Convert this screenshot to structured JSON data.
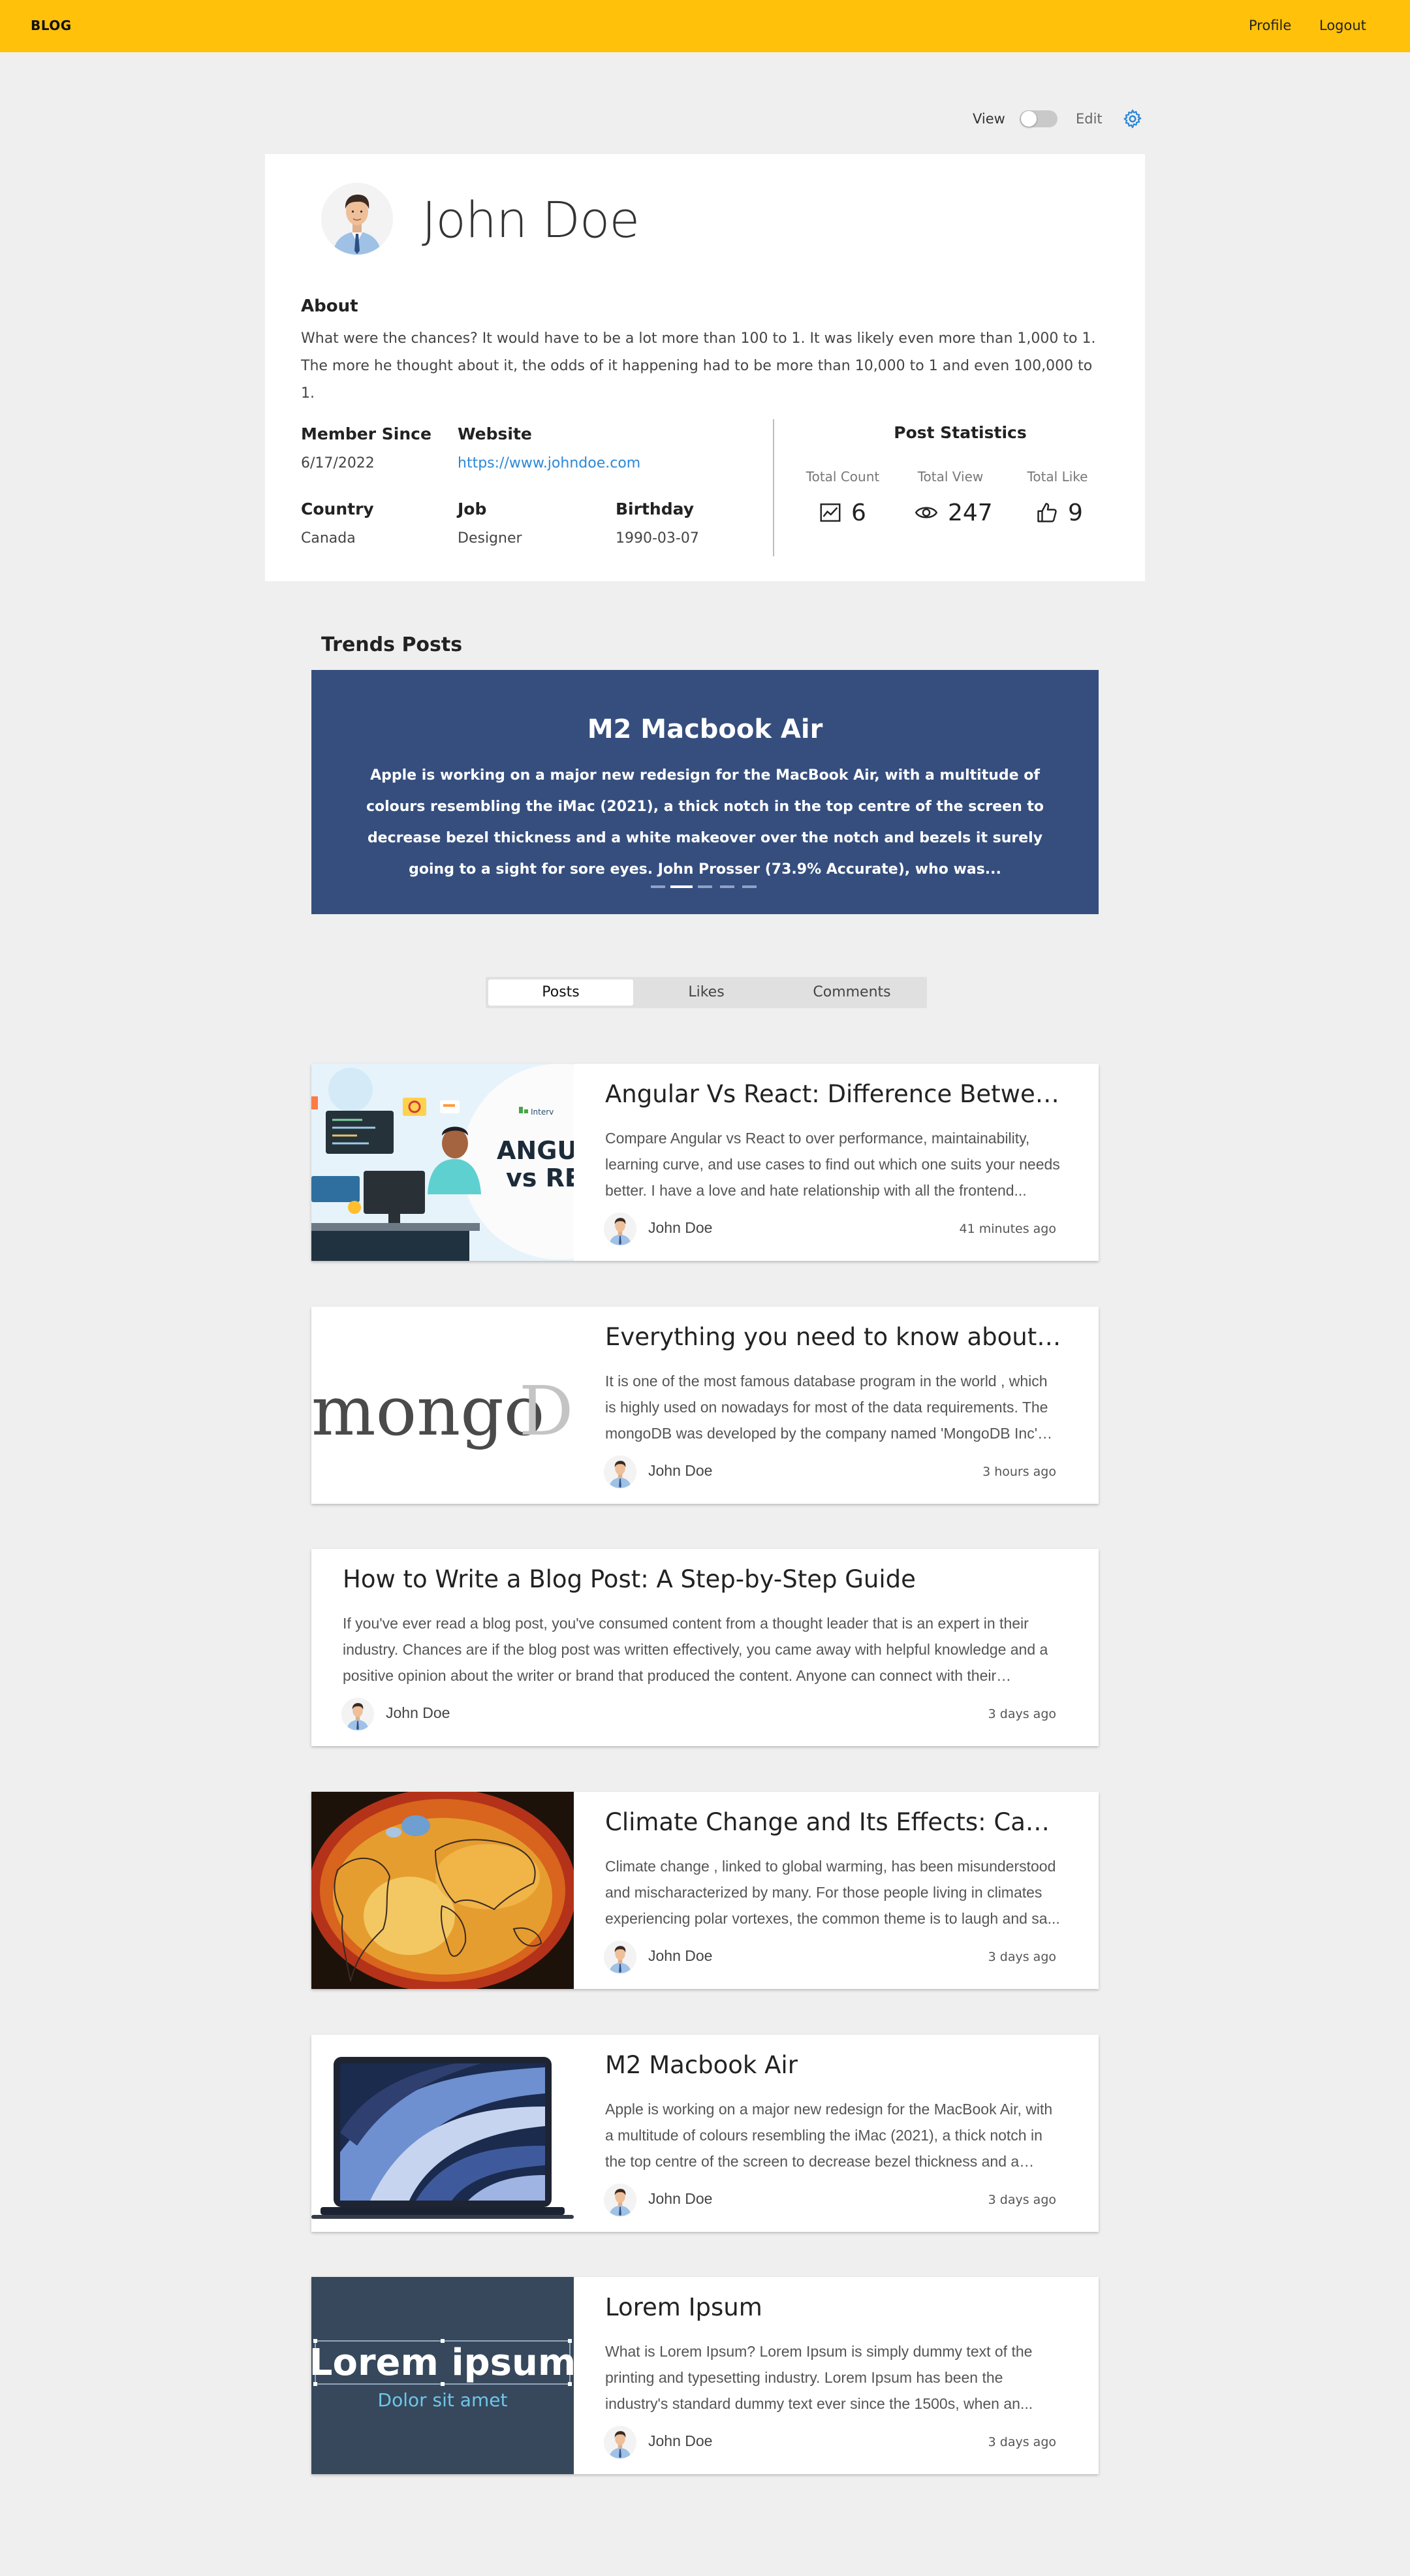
{
  "header": {
    "brand": "BLOG",
    "nav": [
      "Profile",
      "Logout"
    ]
  },
  "mode": {
    "view_label": "View",
    "edit_label": "Edit",
    "toggle_state": "off"
  },
  "profile": {
    "name": "John Doe",
    "about_title": "About",
    "about_text": "What were the chances? It would have to be a lot more than 100 to 1. It was likely even more than 1,000 to 1. The more he thought about it, the odds of it happening had to be more than 10,000 to 1 and even 100,000 to 1.",
    "member_since_label": "Member Since",
    "member_since": "6/17/2022",
    "website_label": "Website",
    "website": "https://www.johndoe.com",
    "country_label": "Country",
    "country": "Canada",
    "job_label": "Job",
    "job": "Designer",
    "birthday_label": "Birthday",
    "birthday": "1990-03-07"
  },
  "stats": {
    "title": "Post Statistics",
    "items": [
      {
        "label": "Total Count",
        "value": "6",
        "icon": "trend-chart-icon"
      },
      {
        "label": "Total View",
        "value": "247",
        "icon": "eye-icon"
      },
      {
        "label": "Total Like",
        "value": "9",
        "icon": "thumbs-up-icon"
      }
    ]
  },
  "trends": {
    "title": "Trends Posts",
    "slide_title": "M2 Macbook Air",
    "slide_text": "Apple is working on a major new redesign for the MacBook Air, with a multitude of colours resembling the iMac (2021), a thick notch in the top centre of the screen to decrease bezel thickness and a white makeover over the notch and bezels it surely going to a sight for sore eyes. John Prosser (73.9% Accurate), who was...",
    "slide_count": 5,
    "active_slide": 2
  },
  "tabs": [
    "Posts",
    "Likes",
    "Comments"
  ],
  "active_tab": "Posts",
  "posts": [
    {
      "title": "Angular Vs React: Difference Between Ang...",
      "excerpt": "Compare Angular vs React to over performance, maintainability, learning curve, and use cases to find out which one suits your needs better. I have a love and hate relationship with all the frontend...",
      "author": "John Doe",
      "time": "41 minutes ago",
      "thumb": "angular-react",
      "thumb_text": [
        "ANGUL",
        "vs REA",
        "Interv"
      ]
    },
    {
      "title": "Everything you need to know about Mong...",
      "excerpt": "It is one of the most famous database program in the world , which is highly used on nowadays for most of the data requirements. The mongoDB was developed by the company named 'MongoDB Inc' a...",
      "author": "John Doe",
      "time": "3 hours ago",
      "thumb": "mongodb",
      "thumb_text": [
        "mongo",
        "D"
      ]
    },
    {
      "title": "How to Write a Blog Post: A Step-by-Step Guide",
      "excerpt": "If you've ever read a blog post, you've consumed content from a thought leader that is an expert in their industry. Chances are if the blog post was written effectively, you came away with helpful knowledge and a positive opinion about the writer or brand that produced the content. Anyone can connect with their audienc...",
      "author": "John Doe",
      "time": "3 days ago",
      "thumb": "none"
    },
    {
      "title": "Climate Change and Its Effects: Can We Un...",
      "excerpt": "Climate change , linked to global warming, has been misunderstood and mischaracterized by many. For those people living in climates experiencing polar vortexes, the common theme is to laugh and sa...",
      "author": "John Doe",
      "time": "3 days ago",
      "thumb": "climate-map"
    },
    {
      "title": "M2 Macbook Air",
      "excerpt": "Apple is working on a major new redesign for the MacBook Air, with a multitude of colours resembling the iMac (2021), a thick notch in the top centre of the screen to decrease bezel thickness and a white...",
      "author": "John Doe",
      "time": "3 days ago",
      "thumb": "macbook"
    },
    {
      "title": "Lorem Ipsum",
      "excerpt": "What is Lorem Ipsum? Lorem Ipsum is simply dummy text of the printing and typesetting industry. Lorem Ipsum has been the industry's standard dummy text ever since the 1500s, when an...",
      "author": "John Doe",
      "time": "3 days ago",
      "thumb": "lorem",
      "thumb_text": [
        "Lorem ipsum",
        "Dolor sit amet"
      ]
    }
  ],
  "colors": {
    "header": "#ffc10a",
    "carousel": "#354e7e",
    "link": "#2d88d8",
    "background": "#efefef"
  }
}
